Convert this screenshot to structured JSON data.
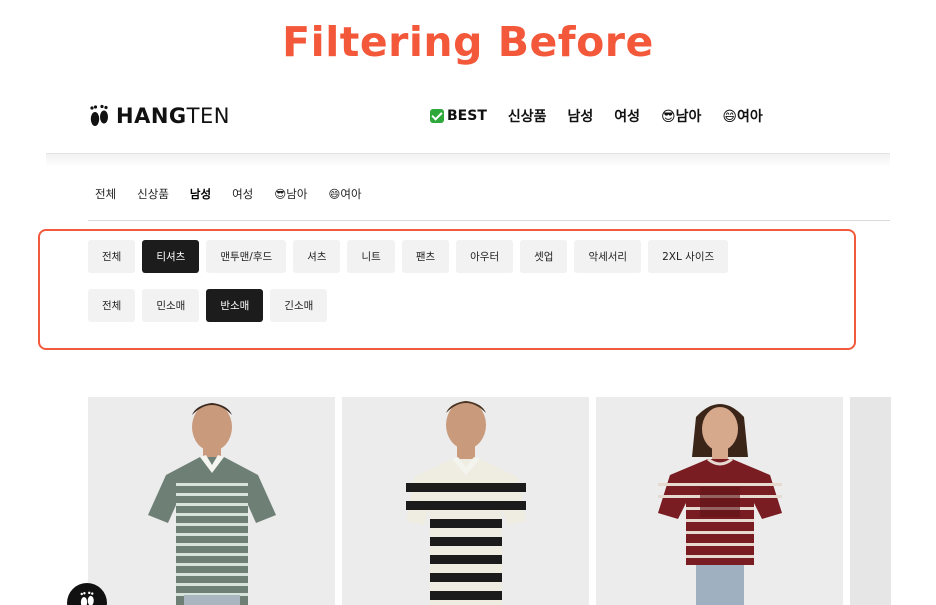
{
  "caption": "Filtering Before",
  "header": {
    "logo": {
      "text_bold": "HANG",
      "text_thin": "TEN",
      "icon": "footprint-icon"
    },
    "nav": [
      {
        "label": "BEST",
        "icon": "check-icon"
      },
      {
        "label": "신상품"
      },
      {
        "label": "남성"
      },
      {
        "label": "여성"
      },
      {
        "label": "😎남아"
      },
      {
        "label": "😄여아"
      }
    ]
  },
  "sub_nav": {
    "items": [
      "전체",
      "신상품",
      "남성",
      "여성",
      "😎남아",
      "😄여아"
    ],
    "active": "남성"
  },
  "filters": {
    "category": [
      "전체",
      "티셔츠",
      "맨투맨/후드",
      "셔츠",
      "니트",
      "팬츠",
      "아우터",
      "셋업",
      "악세서리",
      "2XL 사이즈"
    ],
    "category_selected": "티셔츠",
    "sleeve": [
      "전체",
      "민소매",
      "반소매",
      "긴소매"
    ],
    "sleeve_selected": "반소매"
  },
  "products": [
    {
      "description_icon": "grey-striped-polo-photo",
      "colors": {
        "shirt": "#6e7f76",
        "stripe": "#d9e3de"
      }
    },
    {
      "description_icon": "black-white-striped-polo-photo",
      "colors": {
        "shirt": "#1b1b1b",
        "stripe": "#efece2"
      }
    },
    {
      "description_icon": "burgundy-striped-tee-photo",
      "colors": {
        "shirt": "#7a1d22",
        "stripe": "#e6d9d0"
      }
    }
  ],
  "colors": {
    "accent": "#f4583a",
    "selected_chip": "#1c1c1c",
    "chip": "#f2f2f2"
  },
  "float_button": {
    "icon": "footprint-icon"
  }
}
